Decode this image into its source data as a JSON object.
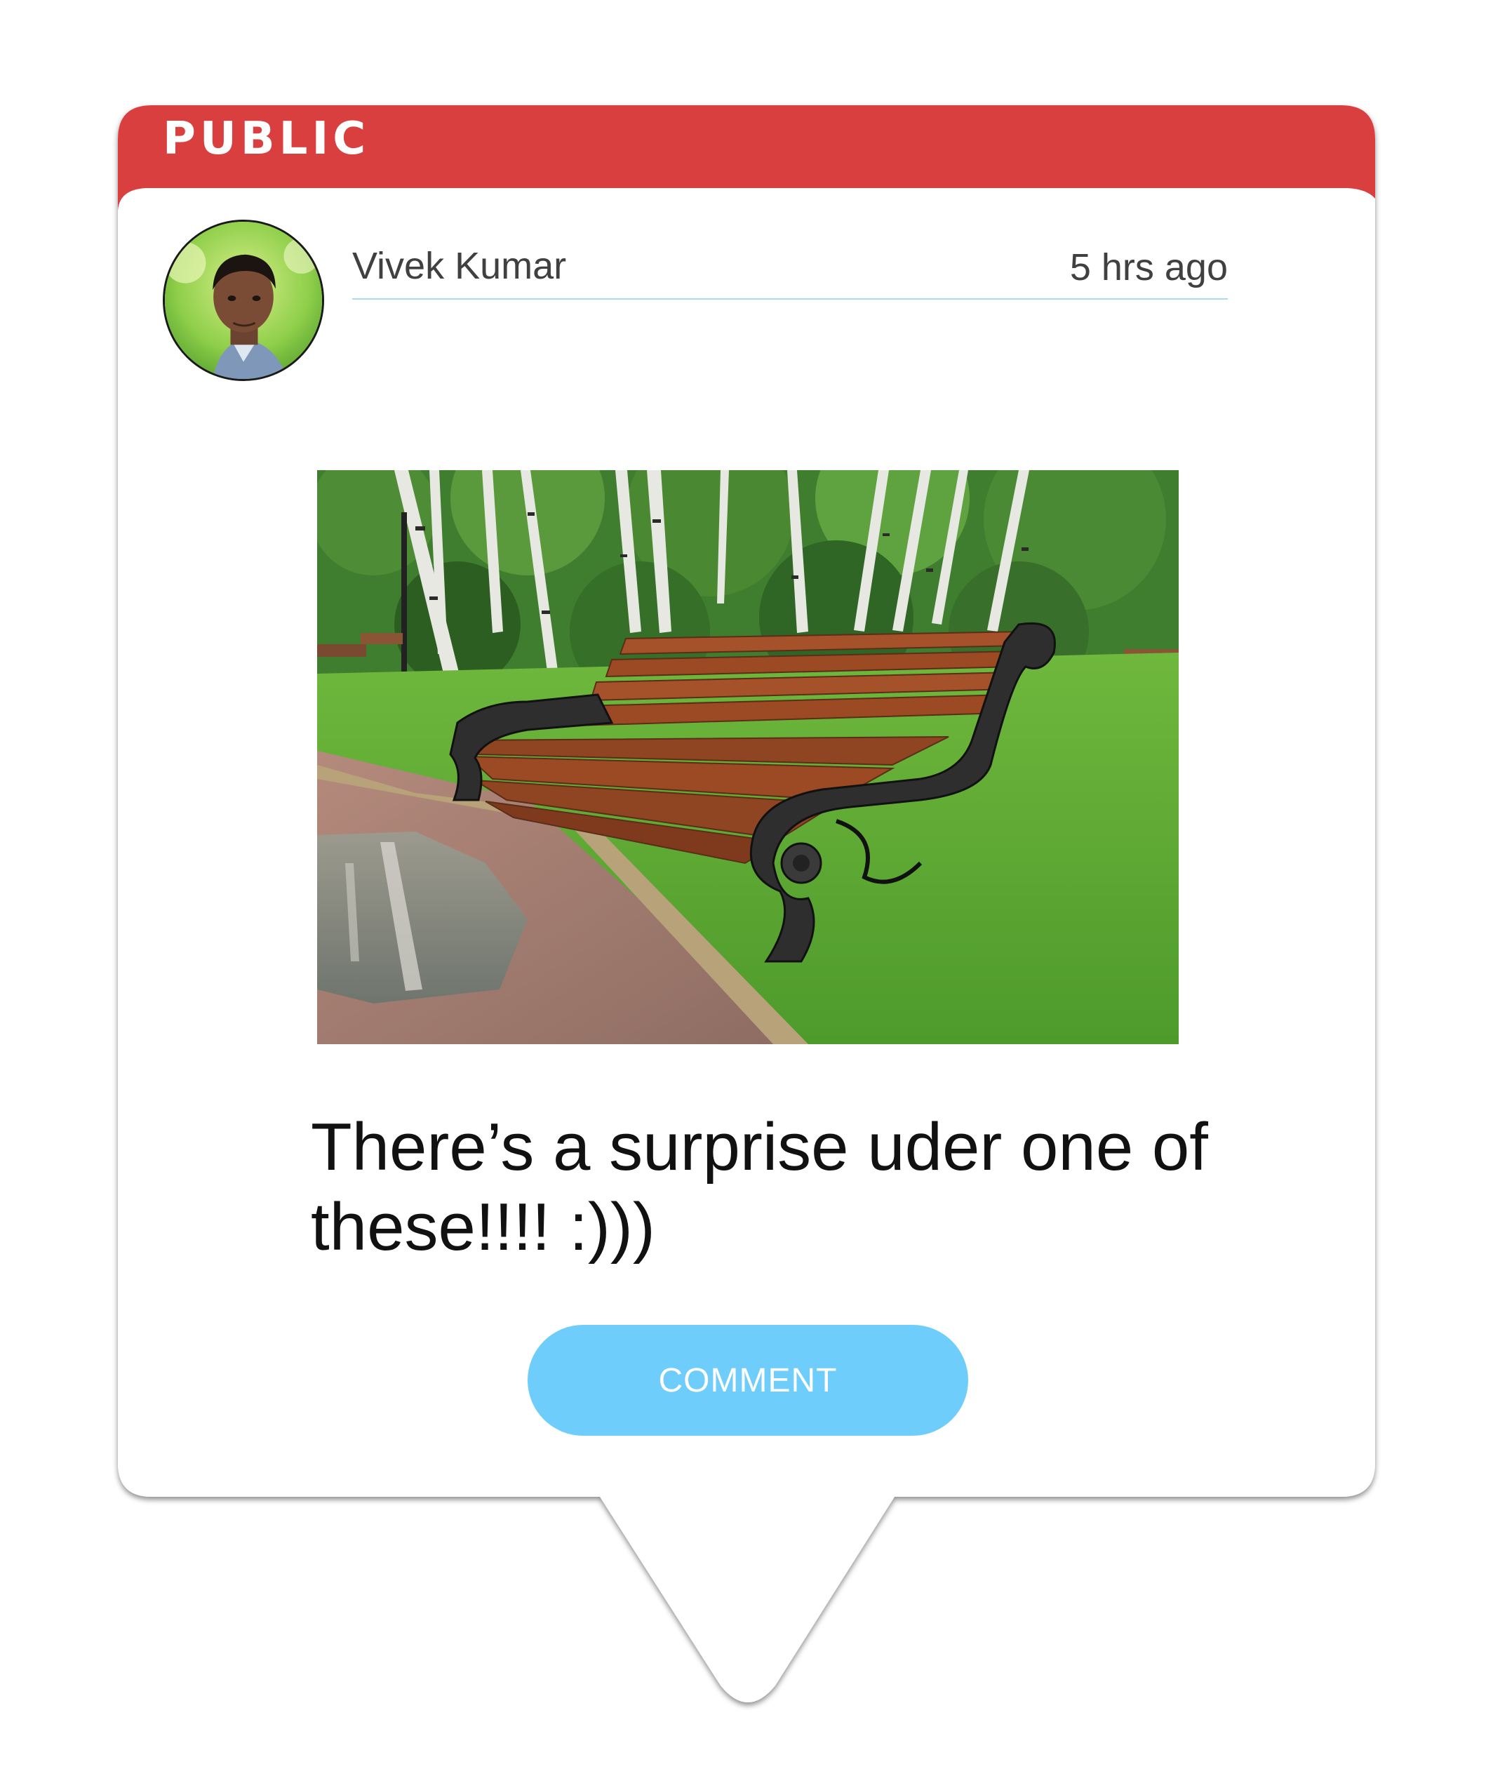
{
  "post": {
    "visibility_label": "PUBLIC",
    "author_name": "Vivek Kumar",
    "timestamp": "5 hrs ago",
    "text": "There’s a surprise uder one of these!!!! :)))",
    "image_alt": "Wooden park bench in a birch grove",
    "comment_button_label": "COMMENT"
  },
  "colors": {
    "header_red": "#d93f3f",
    "button_blue": "#6ecdfb",
    "divider": "#a9dbef",
    "card_background": "#ffffff"
  }
}
